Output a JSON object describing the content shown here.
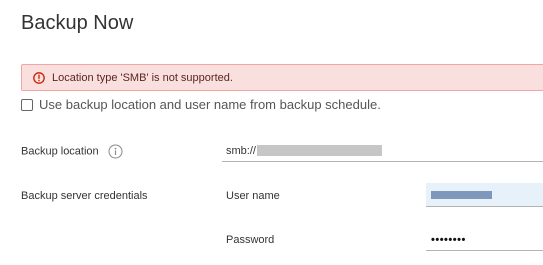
{
  "dialog": {
    "title": "Backup Now"
  },
  "alert": {
    "message": "Location type 'SMB' is not supported.",
    "icon": "error-circle-icon",
    "color": "#c92100"
  },
  "schedule_option": {
    "label": "Use backup location and user name from backup schedule.",
    "checked": false
  },
  "backup_location": {
    "label": "Backup location",
    "info_icon": "info-icon",
    "value_prefix": "smb://"
  },
  "credentials": {
    "label": "Backup server credentials",
    "username_label": "User name",
    "password_label": "Password",
    "password_value": "••••••••"
  }
}
